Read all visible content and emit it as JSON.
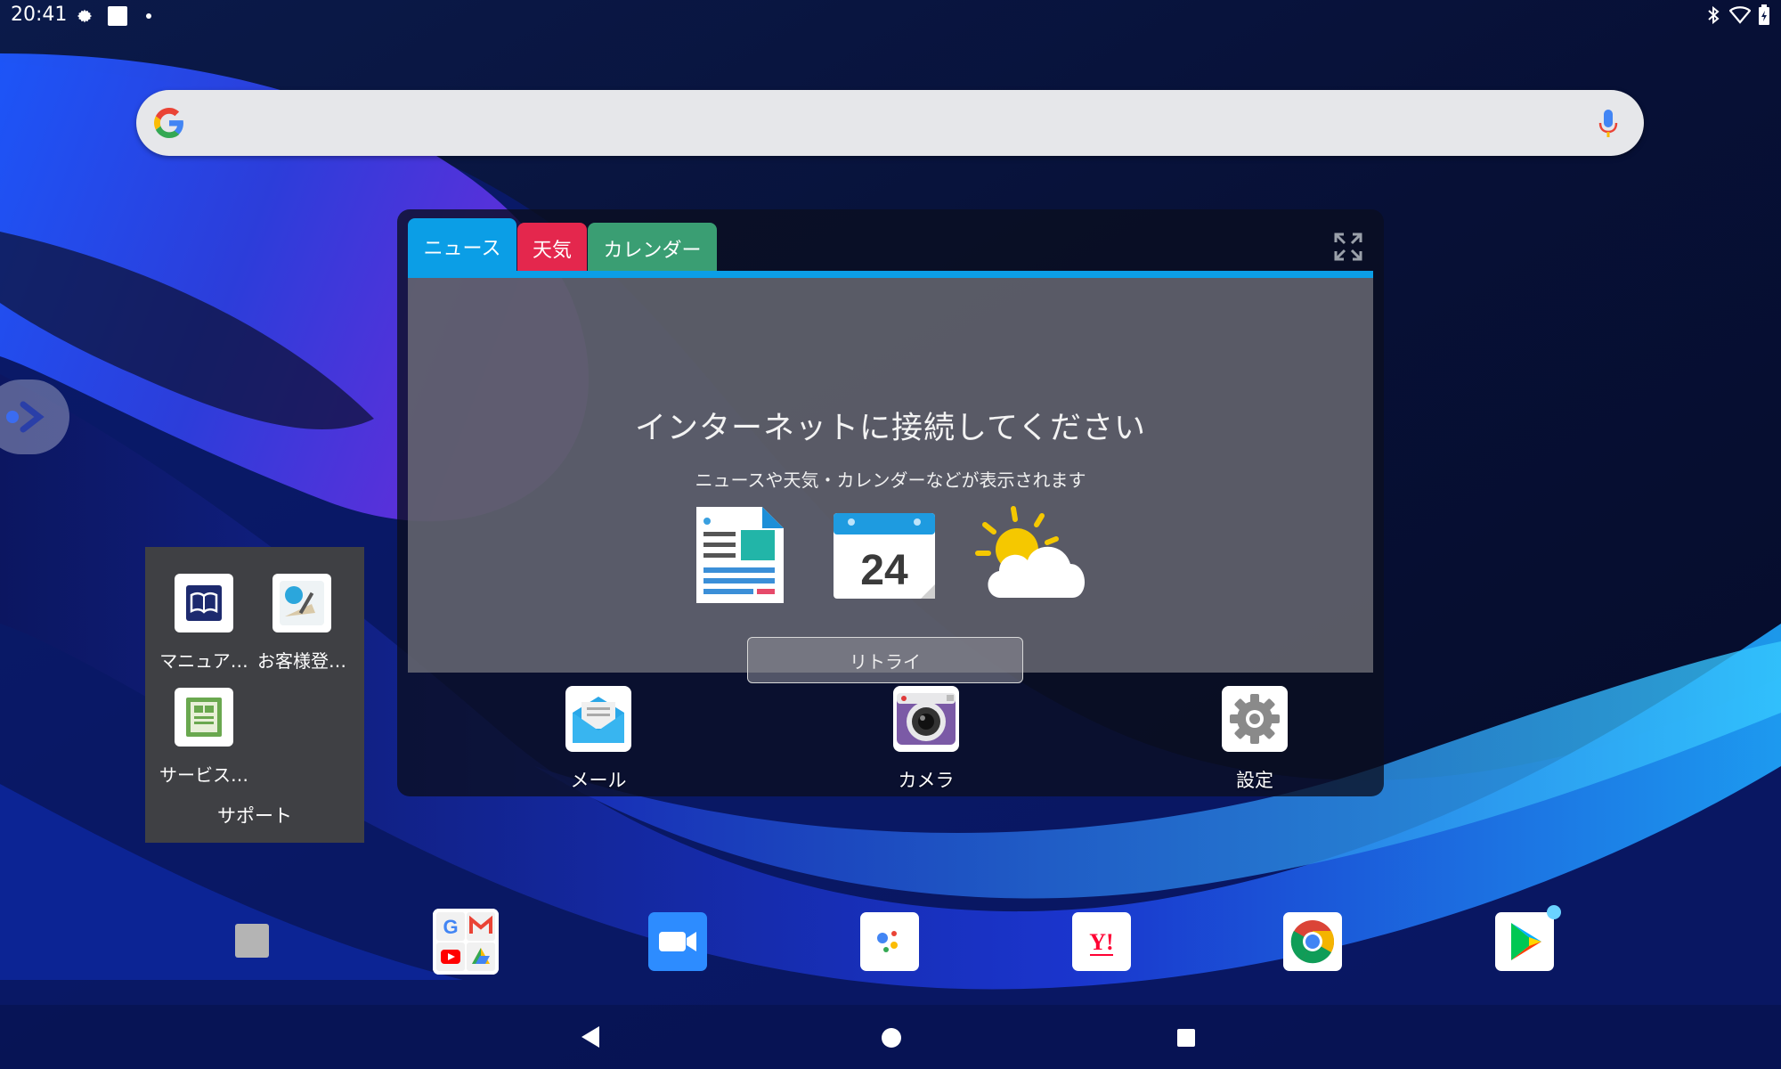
{
  "status_bar": {
    "time": "20:41",
    "left_icons": [
      "gear-icon",
      "square-notification-icon",
      "dot-icon"
    ],
    "right_icons": [
      "bluetooth-icon",
      "wifi-icon",
      "battery-icon"
    ]
  },
  "search_bar": {
    "logo": "google-g-icon",
    "mic": "microphone-icon"
  },
  "widget": {
    "tabs": [
      {
        "label": "ニュース",
        "color": "#0b9ee6"
      },
      {
        "label": "天気",
        "color": "#e4274d"
      },
      {
        "label": "カレンダー",
        "color": "#3a9e73"
      }
    ],
    "expand_icon": "expand-icon",
    "title": "インターネットに接続してください",
    "subtitle": "ニュースや天気・カレンダーなどが表示されます",
    "calendar_number": "24",
    "retry_label": "リトライ"
  },
  "home_apps": [
    {
      "label": "メール",
      "icon": "mail-icon"
    },
    {
      "label": "カメラ",
      "icon": "camera-icon"
    },
    {
      "label": "設定",
      "icon": "settings-gear-icon"
    }
  ],
  "folder": {
    "name": "サポート",
    "apps": [
      {
        "label": "マニュア…",
        "icon": "manual-book-icon"
      },
      {
        "label": "お客様登…",
        "icon": "customer-registration-icon"
      },
      {
        "label": "サービス…",
        "icon": "service-icon"
      }
    ]
  },
  "yahoo_text": "Y!",
  "dock": [
    "empty-app-icon",
    "google-folder-icon",
    "zoom-video-icon",
    "google-assistant-icon",
    "yahoo-icon",
    "chrome-icon",
    "play-store-icon"
  ],
  "nav": [
    "back-icon",
    "home-icon",
    "recents-icon"
  ]
}
